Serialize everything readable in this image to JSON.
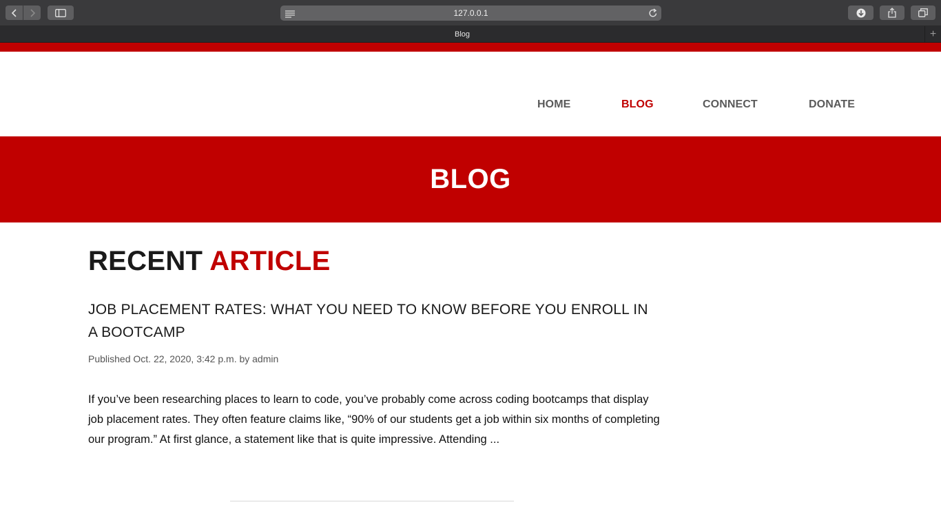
{
  "browser": {
    "url": "127.0.0.1",
    "tab_title": "Blog",
    "new_tab_label": "+",
    "icons": [
      "back-icon",
      "forward-icon",
      "sidebar-icon",
      "reader-icon",
      "reload-icon",
      "download-icon",
      "share-icon",
      "tabs-icon"
    ]
  },
  "nav": {
    "items": [
      {
        "label": "HOME",
        "active": false
      },
      {
        "label": "BLOG",
        "active": true
      },
      {
        "label": "CONNECT",
        "active": false
      },
      {
        "label": "DONATE",
        "active": false
      }
    ]
  },
  "banner": {
    "title": "BLOG"
  },
  "section": {
    "title_part1": "RECENT",
    "title_part2": "ARTICLE"
  },
  "article": {
    "title": "JOB PLACEMENT RATES: WHAT YOU NEED TO KNOW BEFORE YOU ENROLL IN A BOOTCAMP",
    "meta": "Published Oct. 22, 2020, 3:42 p.m. by admin",
    "excerpt": "If you’ve been researching places to learn to code, you’ve probably come across coding bootcamps that display job placement rates. They often feature claims like, “90% of our students get a job within six months of completing our program.” At first glance, a statement like that is quite impressive. Attending ..."
  },
  "colors": {
    "accent": "#c00000",
    "nav_text": "#5a5a5a",
    "chrome": "#3a3a3c"
  }
}
